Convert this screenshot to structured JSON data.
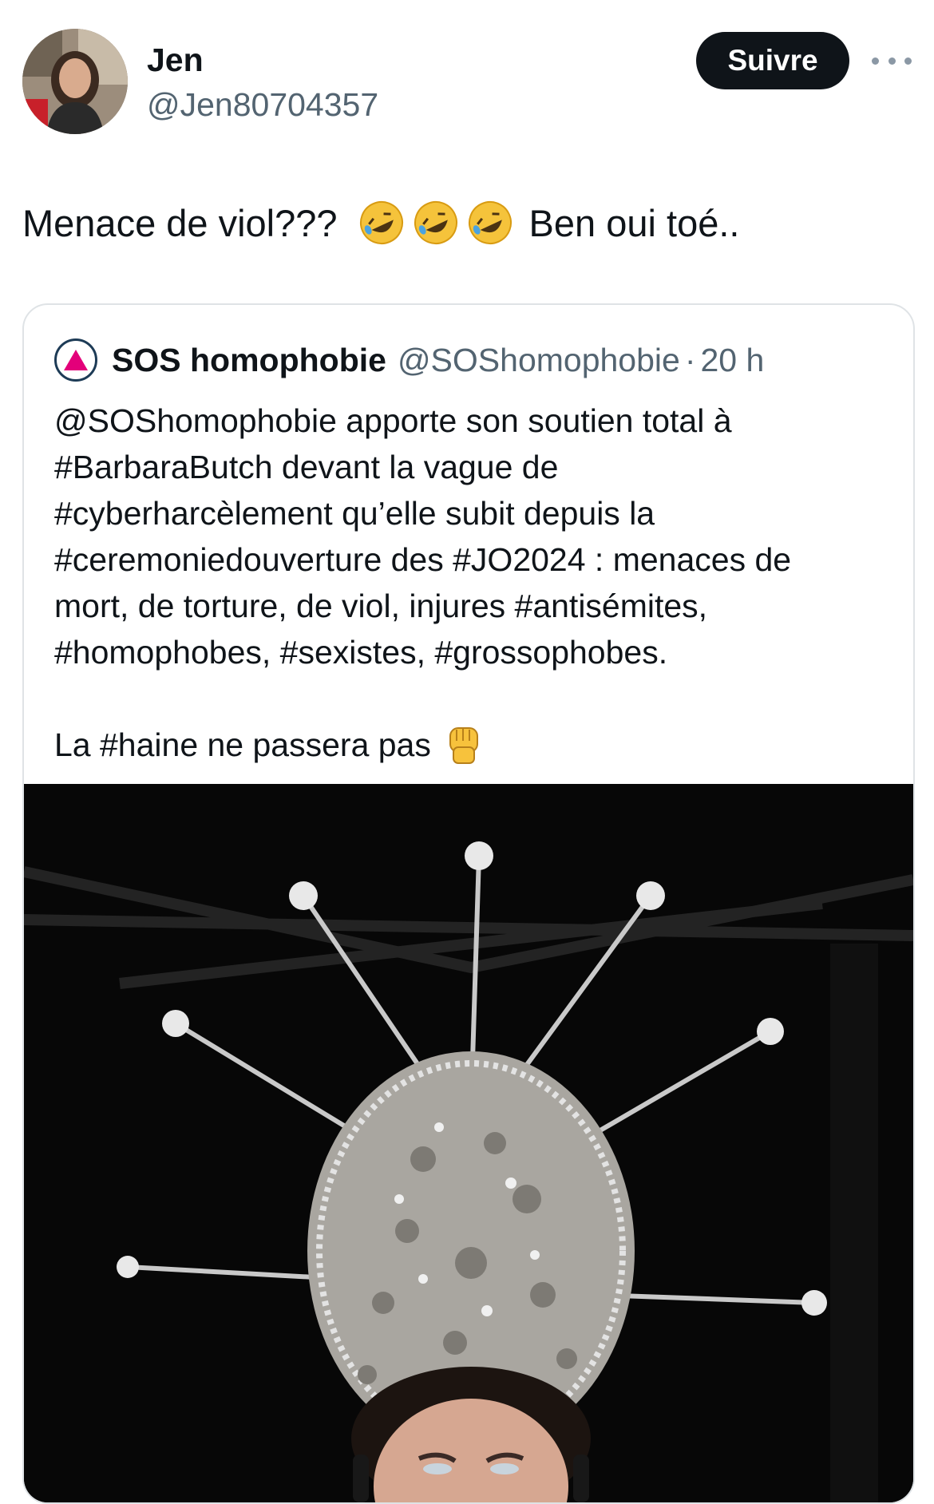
{
  "tweet": {
    "author_name": "Jen",
    "author_handle": "@Jen80704357",
    "follow_label": "Suivre",
    "text_before": "Menace de viol???",
    "text_after": "Ben oui toé..",
    "emojis": [
      "rolling-on-floor-laughing-emoji",
      "rolling-on-floor-laughing-emoji",
      "rolling-on-floor-laughing-emoji"
    ]
  },
  "quoted": {
    "name": "SOS homophobie",
    "handle": "@SOShomophobie",
    "separator": "·",
    "time": "20 h",
    "lines": [
      "@SOShomophobie apporte son soutien total à",
      "#BarbaraButch devant la vague de",
      "#cyberharcèlement qu’elle subit depuis la",
      "#ceremoniedouverture des #JO2024 : menaces de",
      "mort, de torture, de viol, injures #antisémites,",
      "#homophobes, #sexistes, #grossophobes."
    ],
    "last_line": "La #haine ne passera pas",
    "last_emoji": "raised-fist-emoji",
    "media_icon": "photo-crown-headdress"
  },
  "colors": {
    "text": "#0f1419",
    "secondary": "#536471",
    "border": "#dfe3e6",
    "button_bg": "#0f1419",
    "logo_pink": "#e3007a"
  }
}
